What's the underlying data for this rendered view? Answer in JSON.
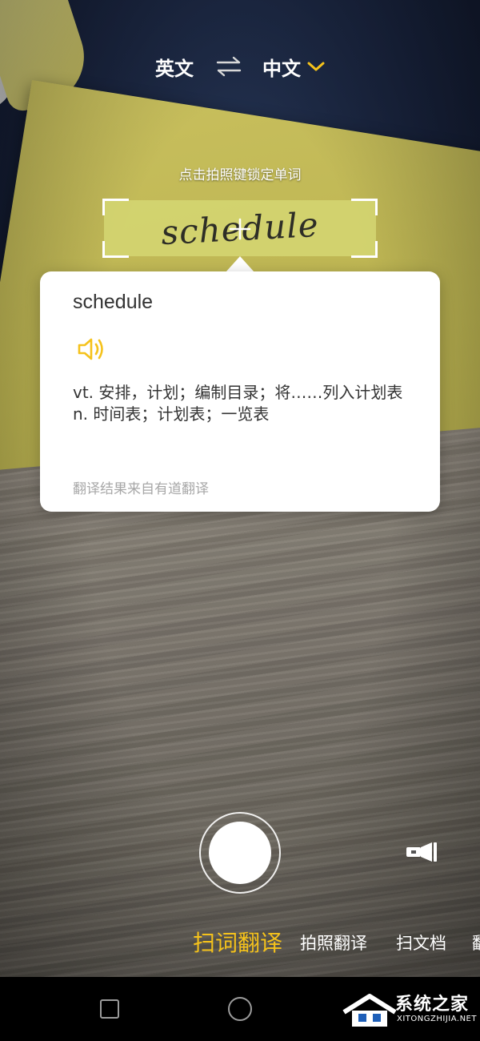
{
  "language_bar": {
    "source_lang": "英文",
    "target_lang": "中文",
    "swap_icon": "swap-arrows-icon",
    "dropdown_icon": "chevron-down-icon",
    "accent_color": "#f5c21b"
  },
  "scan": {
    "hint": "点击拍照键锁定单词",
    "captured_word": "schedule"
  },
  "result_card": {
    "word": "schedule",
    "speaker_icon": "speaker-icon",
    "definitions": [
      "vt. 安排，计划；编制目录；将……列入计划表",
      "n. 时间表；计划表；一览表"
    ],
    "source": "翻译结果来自有道翻译"
  },
  "controls": {
    "shutter_icon": "shutter-button",
    "flashlight_icon": "flashlight-icon"
  },
  "modes": {
    "items": [
      "扫词翻译",
      "拍照翻译",
      "扫文档",
      "翻"
    ],
    "active_index": 0
  },
  "watermark": {
    "title": "系统之家",
    "url": "XITONGZHIJIA.NET"
  }
}
